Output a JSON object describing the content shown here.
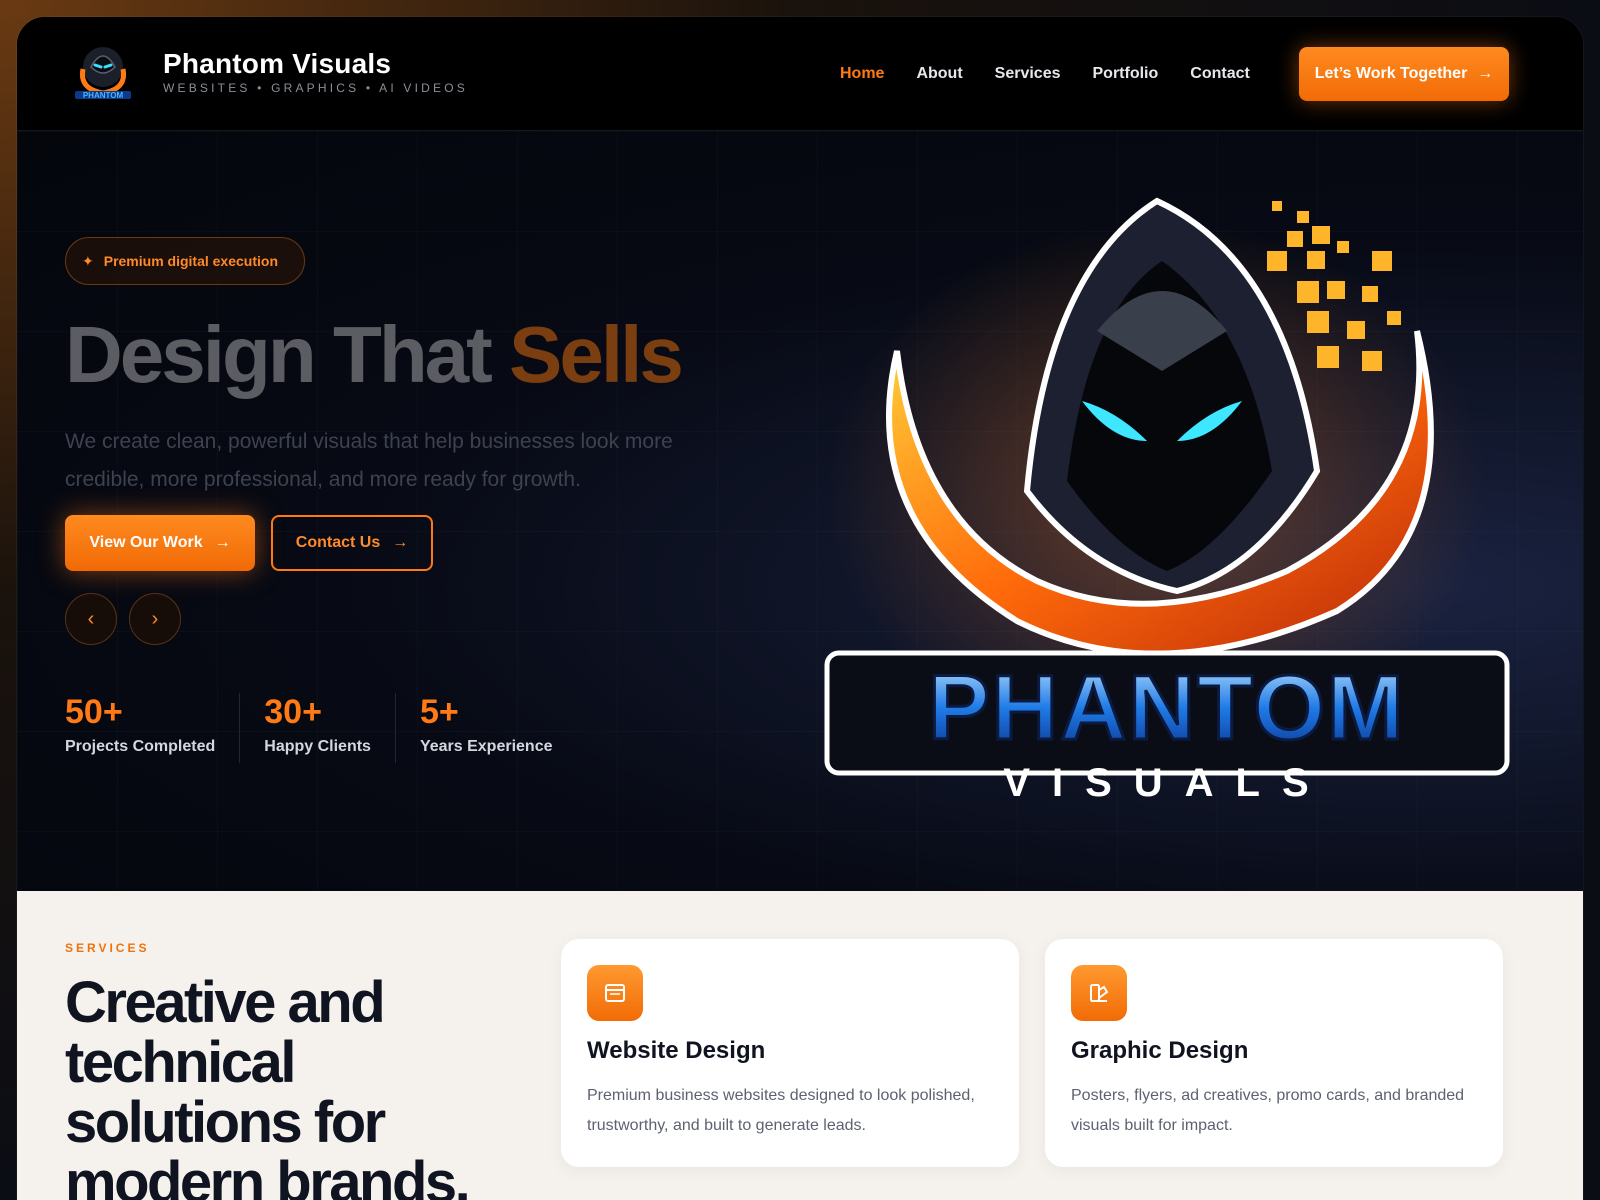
{
  "brand": {
    "title": "Phantom Visuals",
    "tagline": "WEBSITES • GRAPHICS • AI VIDEOS",
    "logo_text_main": "PHANTOM",
    "logo_text_sub": "VISUALS"
  },
  "nav": {
    "items": [
      {
        "label": "Home",
        "active": true
      },
      {
        "label": "About",
        "active": false
      },
      {
        "label": "Services",
        "active": false
      },
      {
        "label": "Portfolio",
        "active": false
      },
      {
        "label": "Contact",
        "active": false
      }
    ],
    "cta_label": "Let’s Work Together"
  },
  "hero": {
    "pill": "Premium digital execution",
    "title_main": "Design That",
    "title_accent": "Sells",
    "description": "We create clean, powerful visuals that help businesses look more credible, more professional, and more ready for growth.",
    "primary_button": "View Our Work",
    "secondary_button": "Contact Us",
    "stats": [
      {
        "value": "50+",
        "label": "Projects Completed"
      },
      {
        "value": "30+",
        "label": "Happy Clients"
      },
      {
        "value": "5+",
        "label": "Years Experience"
      }
    ]
  },
  "services": {
    "eyebrow": "SERVICES",
    "title": "Creative and technical solutions for modern brands.",
    "cards": [
      {
        "title": "Website Design",
        "description": "Premium business websites designed to look polished, trustworthy, and built to generate leads.",
        "icon": "browser-icon"
      },
      {
        "title": "Graphic Design",
        "description": "Posters, flyers, ad creatives, promo cards, and branded visuals built for impact.",
        "icon": "palette-icon"
      }
    ]
  },
  "colors": {
    "accent": "#ff7a12",
    "dark": "#04060c",
    "light_bg": "#f5f2ee"
  }
}
